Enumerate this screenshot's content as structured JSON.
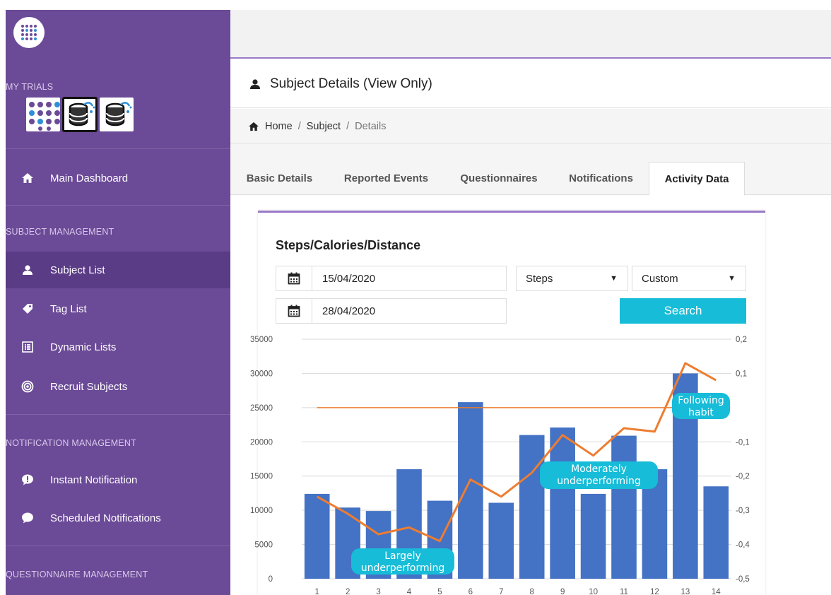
{
  "sidebar": {
    "my_trials_label": "MY TRIALS",
    "trials": [
      "trial-logo-dots",
      "trial-logo-database",
      "trial-logo-database"
    ],
    "main_dashboard": "Main Dashboard",
    "subject_management_label": "SUBJECT MANAGEMENT",
    "subject_list": "Subject List",
    "tag_list": "Tag List",
    "dynamic_lists": "Dynamic Lists",
    "recruit_subjects": "Recruit Subjects",
    "notification_management_label": "NOTIFICATION MANAGEMENT",
    "instant_notification": "Instant Notification",
    "scheduled_notifications": "Scheduled Notifications",
    "questionnaire_management_label": "QUESTIONNAIRE MANAGEMENT"
  },
  "header": {
    "title": "Subject Details (View Only)"
  },
  "breadcrumb": {
    "home": "Home",
    "subject": "Subject",
    "details": "Details",
    "separator": "/"
  },
  "tabs": [
    {
      "label": "Basic Details"
    },
    {
      "label": "Reported Events"
    },
    {
      "label": "Questionnaires"
    },
    {
      "label": "Notifications"
    },
    {
      "label": "Activity Data"
    }
  ],
  "card": {
    "title": "Steps/Calories/Distance",
    "start_date": "15/04/2020",
    "end_date": "28/04/2020",
    "metric_select": "Steps",
    "range_select": "Custom",
    "search_label": "Search"
  },
  "colors": {
    "sidebar": "#6b4a97",
    "accent": "#9a7ac8",
    "bar": "#4472c4",
    "line": "#ed7d31",
    "search": "#17bcd8",
    "callout": "#17bcd8"
  },
  "chart_data": {
    "type": "bar",
    "categories": [
      "1",
      "2",
      "3",
      "4",
      "5",
      "6",
      "7",
      "8",
      "9",
      "10",
      "11",
      "12",
      "13",
      "14"
    ],
    "values": [
      12400,
      10400,
      9900,
      16000,
      11400,
      25800,
      11100,
      21000,
      22100,
      12400,
      20900,
      16000,
      30000,
      13500
    ],
    "y_ticks": [
      "0",
      "5000",
      "10000",
      "15000",
      "20000",
      "25000",
      "30000",
      "35000"
    ],
    "ylim": [
      0,
      35000
    ],
    "reference_line": 25000,
    "secondary": {
      "type": "line",
      "values": [
        -0.26,
        -0.31,
        -0.37,
        -0.35,
        -0.39,
        -0.21,
        -0.26,
        -0.19,
        -0.08,
        -0.14,
        -0.06,
        -0.07,
        0.13,
        0.08
      ],
      "ylim": [
        -0.5,
        0.2
      ],
      "y_ticks": [
        "-0,5",
        "-0,4",
        "-0,3",
        "-0,2",
        "-0,1",
        "0,1",
        "0,2"
      ],
      "y_tick_values": [
        -0.5,
        -0.4,
        -0.3,
        -0.2,
        -0.1,
        0.1,
        0.2
      ]
    },
    "annotations": [
      {
        "lines": [
          "Largely",
          "underperforming"
        ]
      },
      {
        "lines": [
          "Moderately",
          "underperforming"
        ]
      },
      {
        "lines": [
          "Following",
          "habit"
        ]
      }
    ],
    "grid": true
  }
}
